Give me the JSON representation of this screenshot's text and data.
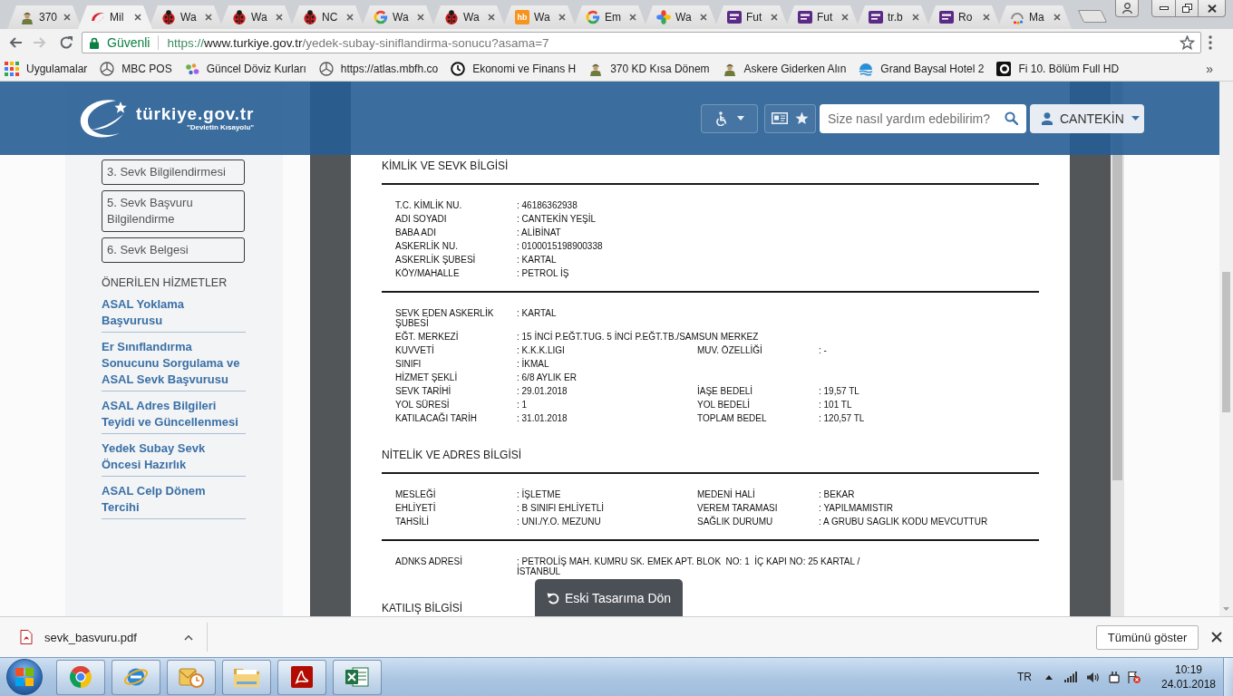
{
  "browser": {
    "tabs": [
      {
        "label": "370",
        "kind": "soldier",
        "selected": false
      },
      {
        "label": "Mil",
        "kind": "swoosh",
        "selected": true
      },
      {
        "label": "Wa",
        "kind": "ladybug",
        "selected": false
      },
      {
        "label": "Wa",
        "kind": "ladybug",
        "selected": false
      },
      {
        "label": "NC",
        "kind": "ladybug",
        "selected": false
      },
      {
        "label": "Wa",
        "kind": "g",
        "selected": false
      },
      {
        "label": "Wa",
        "kind": "ladybug",
        "selected": false
      },
      {
        "label": "Wa",
        "kind": "badge",
        "badge": "hb",
        "selected": false
      },
      {
        "label": "Em",
        "kind": "g",
        "selected": false
      },
      {
        "label": "Wa",
        "kind": "pinwheel",
        "selected": false
      },
      {
        "label": "Fut",
        "kind": "channel",
        "selected": false
      },
      {
        "label": "Fut",
        "kind": "channel",
        "selected": false
      },
      {
        "label": "tr.b",
        "kind": "channel",
        "selected": false
      },
      {
        "label": "Ro",
        "kind": "channel",
        "selected": false
      },
      {
        "label": "Ma",
        "kind": "arc",
        "selected": false
      }
    ],
    "address_bar": {
      "security": "Güvenli",
      "url": {
        "scheme": "https://",
        "host": "www.turkiye.gov.tr",
        "path": "/yedek-subay-siniflandirma-sonucu?asama=7"
      }
    },
    "bookmarks": [
      {
        "label": "Uygulamalar",
        "kind": "apps"
      },
      {
        "label": "MBC POS",
        "kind": "star"
      },
      {
        "label": "Güncel Döviz Kurları",
        "kind": "dots"
      },
      {
        "label": "https://atlas.mbfh.co",
        "kind": "star"
      },
      {
        "label": "Ekonomi ve Finans H",
        "kind": "clock"
      },
      {
        "label": "370 KD Kısa Dönem",
        "kind": "soldier"
      },
      {
        "label": "Askere Giderken Alın",
        "kind": "soldier"
      },
      {
        "label": "Grand Baysal Hotel 2",
        "kind": "wave"
      },
      {
        "label": "Fi 10. Bölüm Full HD",
        "kind": "film"
      }
    ],
    "bookmarks_more": "»"
  },
  "page": {
    "header": {
      "logo_text": "türkiye.gov.tr",
      "logo_tagline": "\"Devletin Kısayolu\"",
      "search": {
        "placeholder": "Size nasıl yardım edebilirim?"
      },
      "user": "CANTEKİN"
    },
    "sidebar": {
      "steps": [
        "3. Sevk Bilgilendirmesi",
        "5. Sevk Başvuru Bilgilendirme",
        "6. Sevk Belgesi"
      ],
      "services_title": "ÖNERİLEN HİZMETLER",
      "services": [
        "ASAL Yoklama Başvurusu",
        "Er Sınıflandırma Sonucunu Sorgulama ve ASAL Sevk Başvurusu",
        "ASAL Adres Bilgileri Teyidi ve Güncellenmesi",
        "Yedek Subay Sevk Öncesi Hazırlık",
        "ASAL Celp Dönem Tercihi"
      ]
    },
    "document": {
      "sections": [
        {
          "title": "KİMLİK VE SEVK BİLGİSİ",
          "blocks": [
            {
              "rows": [
                {
                  "label": "T.C. KİMLİK NU.",
                  "value": ": 46186362938"
                },
                {
                  "label": "ADI SOYADI",
                  "value": ": CANTEKİN YEŞİL"
                },
                {
                  "label": "BABA ADI",
                  "value": ": ALİBİNAT"
                },
                {
                  "label": "ASKERLİK NU.",
                  "value": ": 0100015198900338"
                },
                {
                  "label": "ASKERLİK ŞUBESİ",
                  "value": ": KARTAL"
                },
                {
                  "label": "KÖY/MAHALLE",
                  "value": ": PETROL İŞ"
                }
              ]
            },
            {
              "rows": [
                {
                  "label": "SEVK EDEN ASKERLİK ŞUBESİ",
                  "value": ": KARTAL"
                },
                {
                  "label": "EĞT. MERKEZİ",
                  "value": ": 15 İNCİ P.EĞT.TUG. 5 İNCİ P.EĞT.TB./SAMSUN MERKEZ"
                },
                {
                  "label": "KUVVETİ",
                  "value": ": K.K.K.LIGI",
                  "label_2": "MUV. ÖZELLİĞİ",
                  "value_2": ": -"
                },
                {
                  "label": "SINIFI",
                  "value": ": İKMAL"
                },
                {
                  "label": "HİZMET ŞEKLİ",
                  "value": ": 6/8 AYLIK ER"
                },
                {
                  "label": "SEVK TARİHİ",
                  "value": ": 29.01.2018",
                  "label_2": "İAŞE BEDELİ",
                  "value_2": ": 19,57 TL"
                },
                {
                  "label": "YOL SÜRESİ",
                  "value": ": 1",
                  "label_2": "YOL BEDELİ",
                  "value_2": ": 101 TL"
                },
                {
                  "label": "KATILACAĞI TARİH",
                  "value": ": 31.01.2018",
                  "label_2": "TOPLAM BEDEL",
                  "value_2": ": 120,57 TL"
                }
              ]
            }
          ]
        },
        {
          "title": "NİTELİK VE ADRES BİLGİSİ",
          "blocks": [
            {
              "rows": [
                {
                  "label": "MESLEĞİ",
                  "value": ": İŞLETME",
                  "label_2": "MEDENİ HALİ",
                  "value_2": ": BEKAR"
                },
                {
                  "label": "EHLİYETİ",
                  "value": ": B SINIFI EHLİYETLİ",
                  "label_2": "VEREM TARAMASI",
                  "value_2": ": YAPILMAMISTIR"
                },
                {
                  "label": "TAHSİLİ",
                  "value": ": UNI./Y.O. MEZUNU",
                  "label_2": "SAĞLIK DURUMU",
                  "value_2": ": A GRUBU SAGLIK KODU MEVCUTTUR"
                }
              ]
            },
            {
              "rows": [
                {
                  "label": "ADNKS ADRESİ",
                  "value": ": PETROLİŞ MAH. KUMRU SK. EMEK APT. BLOK  NO: 1  İÇ KAPI NO: 25 KARTAL / İSTANBUL"
                }
              ]
            }
          ]
        },
        {
          "title": "KATILIŞ BİLGİSİ"
        }
      ]
    },
    "old_design_button": "Eski Tasarıma Dön"
  },
  "downloads": {
    "file": "sevk_basvuru.pdf",
    "show_all": "Tümünü göster"
  },
  "taskbar": {
    "language": "TR",
    "time": "10:19",
    "date": "24.01.2018"
  }
}
